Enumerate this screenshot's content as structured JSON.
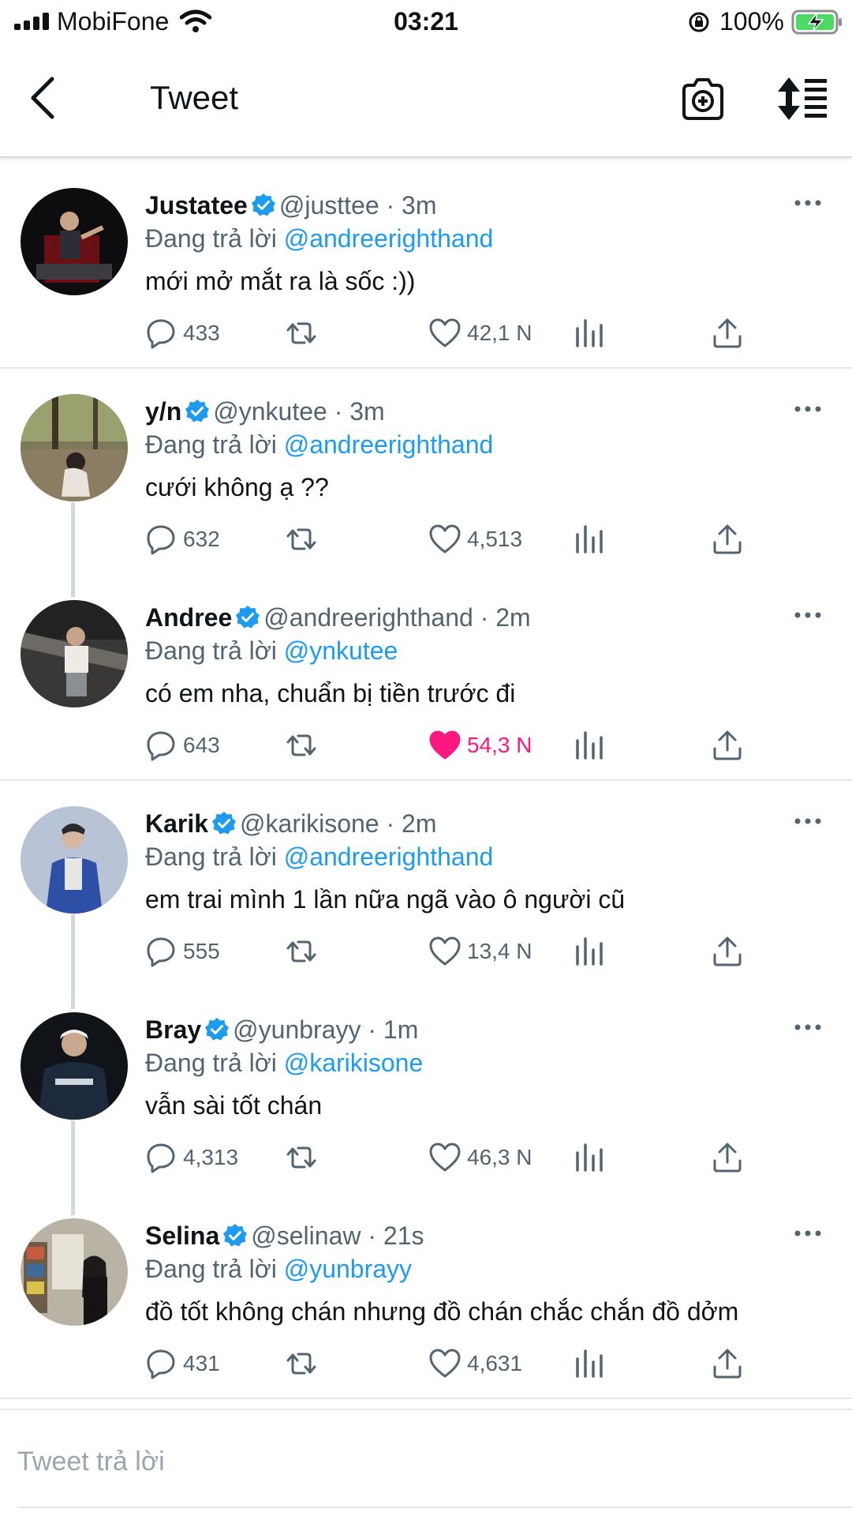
{
  "status_bar": {
    "carrier": "MobiFone",
    "time": "03:21",
    "battery": "100%"
  },
  "header": {
    "title": "Tweet"
  },
  "theme": {
    "accent": "#1d9bf0",
    "like": "#f91880",
    "muted": "#536471"
  },
  "tweets": [
    {
      "name": "Justatee",
      "handle": "@justtee",
      "dot": "·",
      "time": "3m",
      "reply_prefix": "Đang trả lời",
      "reply_to": "@andreerighthand",
      "text": "mới mở mắt ra là sốc :))",
      "replies": "433",
      "likes": "42,1 N",
      "liked": false
    },
    {
      "name": "y/n",
      "handle": "@ynkutee",
      "dot": "·",
      "time": "3m",
      "reply_prefix": "Đang trả lời",
      "reply_to": "@andreerighthand",
      "text": "cưới không ạ ??",
      "replies": "632",
      "likes": "4,513",
      "liked": false
    },
    {
      "name": "Andree",
      "handle": "@andreerighthand",
      "dot": "·",
      "time": "2m",
      "reply_prefix": "Đang trả lời",
      "reply_to": "@ynkutee",
      "text": "có em nha, chuẩn bị tiền trước đi",
      "replies": "643",
      "likes": "54,3 N",
      "liked": true
    },
    {
      "name": "Karik",
      "handle": "@karikisone",
      "dot": "·",
      "time": "2m",
      "reply_prefix": "Đang trả lời",
      "reply_to": "@andreerighthand",
      "text": "em trai mình 1 lần nữa ngã vào ô người cũ",
      "replies": "555",
      "likes": "13,4 N",
      "liked": false
    },
    {
      "name": "Bray",
      "handle": "@yunbrayy",
      "dot": "·",
      "time": "1m",
      "reply_prefix": "Đang trả lời",
      "reply_to": "@karikisone",
      "text": "vẫn sài tốt chán",
      "replies": "4,313",
      "likes": "46,3 N",
      "liked": false
    },
    {
      "name": "Selina",
      "handle": "@selinaw",
      "dot": "·",
      "time": "21s",
      "reply_prefix": "Đang trả lời",
      "reply_to": "@yunbrayy",
      "text": "đồ tốt không chán nhưng đồ chán chắc chắn đồ dởm",
      "replies": "431",
      "likes": "4,631",
      "liked": false
    }
  ],
  "compose": {
    "placeholder": "Tweet trả lời"
  }
}
